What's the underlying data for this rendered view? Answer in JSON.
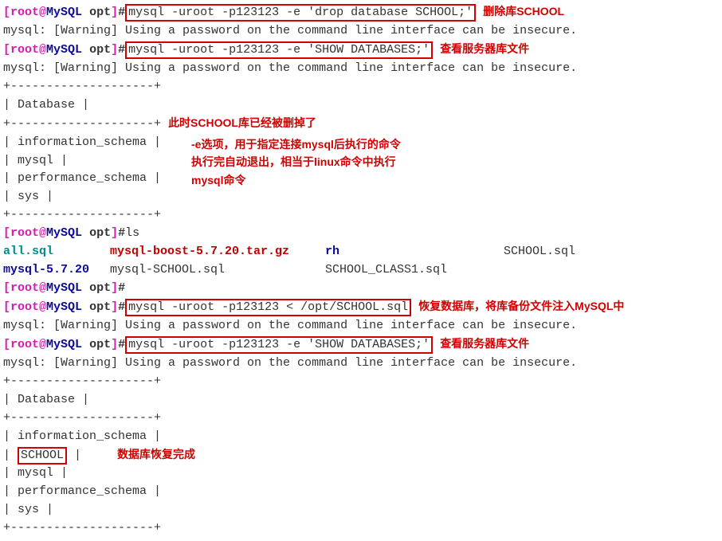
{
  "prompt": {
    "open": "[",
    "user": "root",
    "at": "@",
    "host": "MySQL",
    "path": " opt",
    "close": "]",
    "hash": "#"
  },
  "lines": {
    "cmd_drop": "mysql -uroot -p123123 -e 'drop database SCHOOL;'",
    "annot_drop": "删除库SCHOOL",
    "warn": "mysql: [Warning] Using a password on the command line interface can be insecure.",
    "cmd_show1": "mysql -uroot -p123123 -e 'SHOW DATABASES;'",
    "annot_show1": "查看服务器库文件",
    "tbl_border": "+--------------------+",
    "tbl_header": "| Database           |",
    "tbl_info": "| information_schema |",
    "tbl_mysql": "| mysql              |",
    "tbl_perf": "| performance_schema |",
    "tbl_sys": "| sys                |",
    "tbl_school": "| ",
    "tbl_school_name": "SCHOOL",
    "tbl_school_pad": "             |",
    "annot_deleted": "此时SCHOOL库已经被删掉了",
    "annot_e1": "-e选项，用于指定连接mysql后执行的命令",
    "annot_e2": "执行完自动退出，相当于linux命令中执行",
    "annot_e3": "mysql命令",
    "cmd_ls": "ls",
    "ls_row1_c1": "all.sql",
    "ls_row1_c2": "mysql-boost-5.7.20.tar.gz",
    "ls_row1_c3": "rh",
    "ls_row1_c4": "SCHOOL.sql",
    "ls_row2_c1": "mysql-5.7.20",
    "ls_row2_c2": "mysql-SCHOOL.sql",
    "ls_row2_c3": "SCHOOL_CLASS1.sql",
    "cmd_restore": "mysql -uroot -p123123 < /opt/SCHOOL.sql",
    "annot_restore": "恢复数据库，将库备份文件注入MySQL中",
    "cmd_show2": "mysql -uroot -p123123 -e 'SHOW DATABASES;'",
    "annot_show2": "查看服务器库文件",
    "annot_done": "数据库恢复完成"
  }
}
